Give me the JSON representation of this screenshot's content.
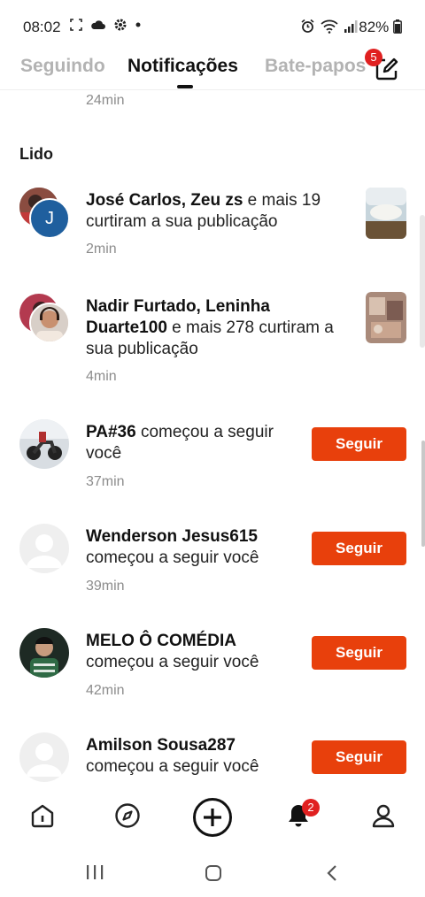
{
  "status_bar": {
    "time": "08:02",
    "battery": "82%"
  },
  "tabs": [
    {
      "label": "Seguindo"
    },
    {
      "label": "Notificações"
    },
    {
      "label": "Bate-papos"
    }
  ],
  "compose_badge": "5",
  "feed": {
    "top_time": "24min",
    "section_title": "Lido",
    "notifications": [
      {
        "actors": "José Carlos, Zeu zs",
        "rest": " e mais 19 curtiram a sua publicação",
        "time": "2min"
      },
      {
        "actors": "Nadir Furtado, Leninha Duarte100",
        "rest": " e mais 278 curtiram a sua publicação",
        "time": "4min"
      },
      {
        "actor": "PA#36",
        "rest": " começou a seguir você",
        "time": "37min",
        "button": "Seguir"
      },
      {
        "actor": "Wenderson Jesus615",
        "rest": "começou a seguir você",
        "time": "39min",
        "button": "Seguir"
      },
      {
        "actor": "MELO Ô COMÉDIA",
        "rest": "começou a seguir você",
        "time": "42min",
        "button": "Seguir"
      },
      {
        "actor": "Amilson Sousa287",
        "rest": "começou a seguir você",
        "time": "",
        "button": "Seguir"
      }
    ]
  },
  "bottom_nav": {
    "items": [
      {
        "icon": "home-icon"
      },
      {
        "icon": "compass-icon"
      },
      {
        "icon": "add-icon"
      },
      {
        "icon": "bell-icon"
      },
      {
        "icon": "profile-icon"
      }
    ],
    "bell_badge": "2"
  },
  "colors": {
    "accent": "#e8400c",
    "badge": "#e02020"
  }
}
